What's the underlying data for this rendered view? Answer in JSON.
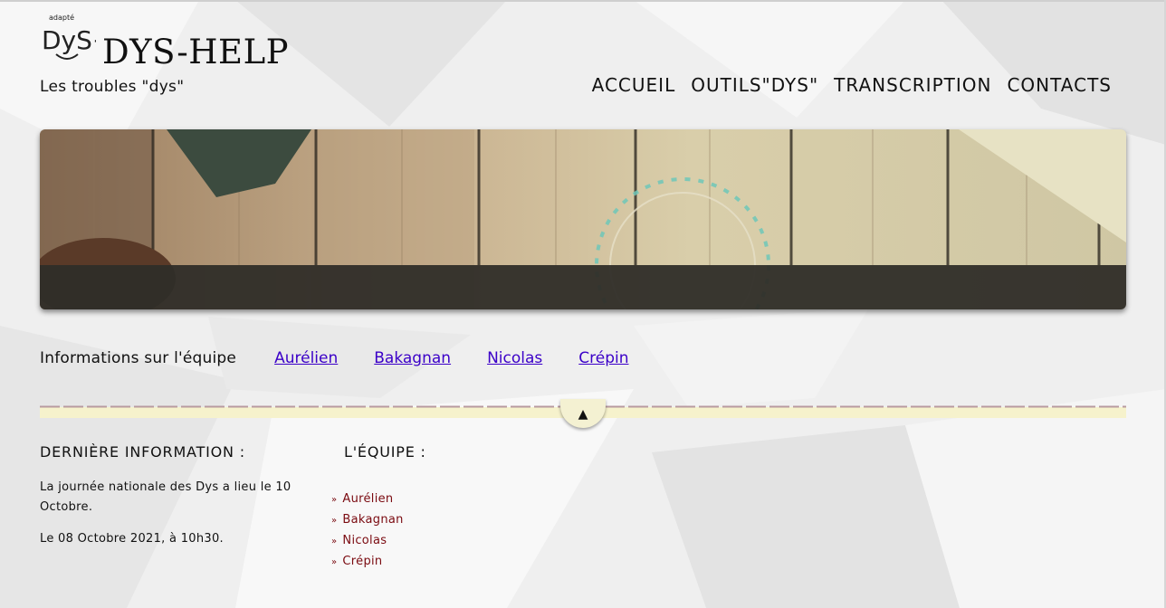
{
  "header": {
    "logo_text": "DyS+",
    "logo_small_text": "adapté",
    "site_title": "DYS-HELP",
    "tagline": "Les troubles \"dys\""
  },
  "nav": {
    "items": [
      {
        "label": "ACCUEIL"
      },
      {
        "label": "OUTILS\"DYS\""
      },
      {
        "label": "TRANSCRIPTION"
      },
      {
        "label": "CONTACTS"
      }
    ]
  },
  "team_links": {
    "label": "Informations sur l'équipe",
    "members": [
      "Aurélien",
      "Bakagnan",
      "Nicolas",
      "Crépin"
    ]
  },
  "footer": {
    "news_title": "DERNIÈRE INFORMATION :",
    "news_lines": [
      "La journée nationale des Dys a lieu le 10 Octobre.",
      "Le 08 Octobre 2021, à 10h30."
    ],
    "team_title": "L'ÉQUIPE :",
    "team_list": [
      "Aurélien",
      "Bakagnan",
      "Nicolas",
      "Crépin"
    ],
    "list_bullet": "»"
  },
  "scroll_top_icon": "triangle-up-icon",
  "colors": {
    "link": "#3b00c8",
    "footer_link": "#7a0a10",
    "separator": "#f6f2cc"
  }
}
